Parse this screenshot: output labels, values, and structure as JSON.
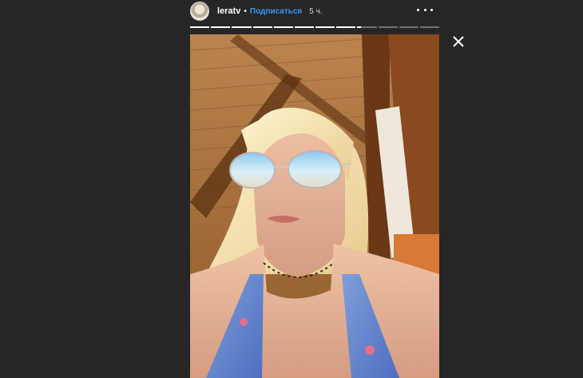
{
  "header": {
    "username": "leratv",
    "separator": "•",
    "follow_label": "Подписаться",
    "time_ago": "5 ч."
  },
  "progress": {
    "segments": [
      1,
      1,
      1,
      1,
      1,
      1,
      1,
      1,
      0.2,
      0,
      0,
      0
    ]
  },
  "icons": {
    "avatar": "avatar",
    "more": "more-options-icon",
    "close": "close-icon"
  },
  "colors": {
    "background": "#262626",
    "link": "#3897f0",
    "text": "#ffffff"
  }
}
